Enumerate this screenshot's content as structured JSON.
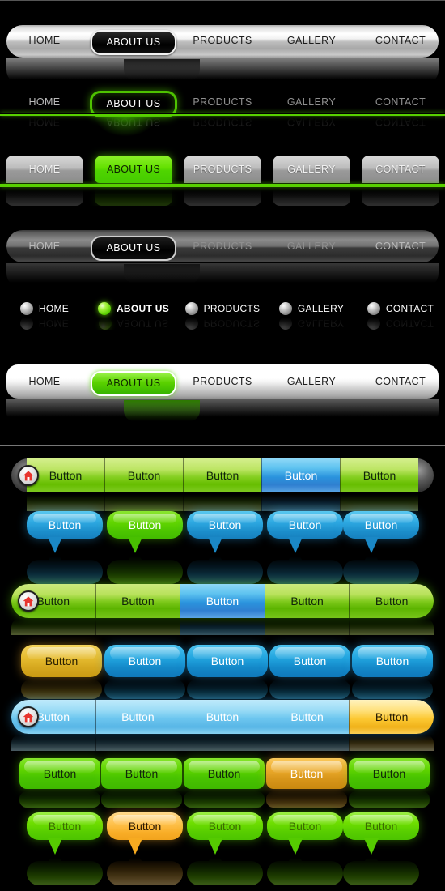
{
  "nav_labels": [
    "HOME",
    "ABOUT US",
    "PRODUCTS",
    "GALLERY",
    "CONTACT"
  ],
  "button_label": "Button",
  "colors": {
    "green_accent": "#5ad000",
    "green_bright": "#7ec91b",
    "blue_accent": "#2a93dd",
    "cyan_light": "#9bdcf6",
    "yellow_accent": "#fcc832",
    "orange_accent": "#eaa92a",
    "silver_light": "#ffffff",
    "silver_mid": "#bdbdbd",
    "dark_gray": "#2c2c2c",
    "background": "#000000",
    "home_icon_red": "#e8352e"
  },
  "panels": [
    {
      "name": "navigation-bars",
      "rows": [
        {
          "id": "nav-silver-pill",
          "style": "silver-pill-bar",
          "active_index": 1,
          "active_style": "black-capsule"
        },
        {
          "id": "nav-green-outline",
          "style": "transparent-green-line",
          "active_index": 1,
          "active_style": "green-outline-capsule"
        },
        {
          "id": "nav-tabs",
          "style": "tab-strip-green-line",
          "active_index": 1,
          "active_style": "green-tab"
        },
        {
          "id": "nav-dark-pill",
          "style": "dark-pill-bar",
          "active_index": 1,
          "active_style": "black-capsule"
        },
        {
          "id": "nav-dots",
          "style": "sphere-bullets",
          "active_index": 1,
          "active_style": "green-sphere"
        },
        {
          "id": "nav-white-pill",
          "style": "white-pill-bar",
          "active_index": 1,
          "active_style": "green-capsule"
        }
      ]
    },
    {
      "name": "button-bars",
      "rows": [
        {
          "id": "btnbar-green-segmented",
          "style": "segmented-flat-dark-caps",
          "count": 5,
          "active_index": 3,
          "active_color": "blue",
          "base_color": "green",
          "has_home_icon": true
        },
        {
          "id": "bubble-row-blue",
          "style": "speech-bubble",
          "count": 5,
          "active_index": 1,
          "active_color": "green",
          "base_color": "blue",
          "has_home_icon": false
        },
        {
          "id": "btnbar-green-rounded",
          "style": "segmented-rounded",
          "count": 5,
          "active_index": 2,
          "active_color": "cyan",
          "base_color": "green",
          "has_home_icon": true
        },
        {
          "id": "pill-row-blue",
          "style": "separate-pills",
          "count": 5,
          "active_index": 0,
          "active_color": "gold",
          "base_color": "blue",
          "has_home_icon": false
        },
        {
          "id": "btnbar-blue-rounded",
          "style": "segmented-rounded",
          "count": 5,
          "active_index": 4,
          "active_color": "yellow",
          "base_color": "blue-lite",
          "has_home_icon": true
        },
        {
          "id": "btn-row-green-separate",
          "style": "separate-rounded",
          "count": 5,
          "active_index": 3,
          "active_color": "orange",
          "base_color": "green",
          "has_home_icon": false
        },
        {
          "id": "bubble-row-green",
          "style": "speech-bubble",
          "count": 5,
          "active_index": 1,
          "active_color": "orange",
          "base_color": "green",
          "has_home_icon": false
        }
      ]
    }
  ]
}
